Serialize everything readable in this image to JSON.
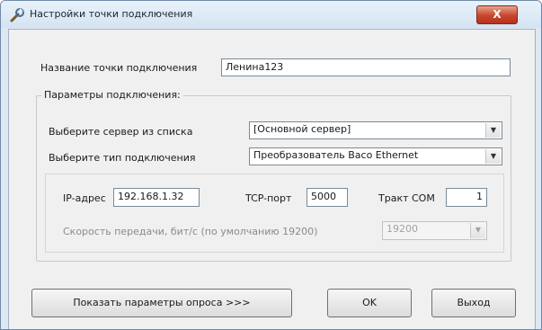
{
  "window": {
    "title": "Настройки точки подключения",
    "close_label": "X"
  },
  "connection_point": {
    "label": "Название точки подключения",
    "value": "Ленина123"
  },
  "params_group": {
    "title": "Параметры подключения:",
    "server_label": "Выберите сервер из списка",
    "server_value": "[Основной сервер]",
    "type_label": "Выберите тип подключения",
    "type_value": "Преобразователь Baco Ethernet"
  },
  "network": {
    "ip_label": "IP-адрес",
    "ip_value": "192.168.1.32",
    "tcp_label": "TCP-порт",
    "tcp_value": "5000",
    "com_label": "Тракт СОМ",
    "com_value": "1",
    "speed_label": "Скорость передачи, бит/с (по умолчанию 19200)",
    "speed_value": "19200"
  },
  "buttons": {
    "show_params": "Показать параметры опроса >>>",
    "ok": "OK",
    "exit": "Выход"
  },
  "icons": {
    "app": "wrench-icon",
    "dropdown": "chevron-down-icon"
  }
}
